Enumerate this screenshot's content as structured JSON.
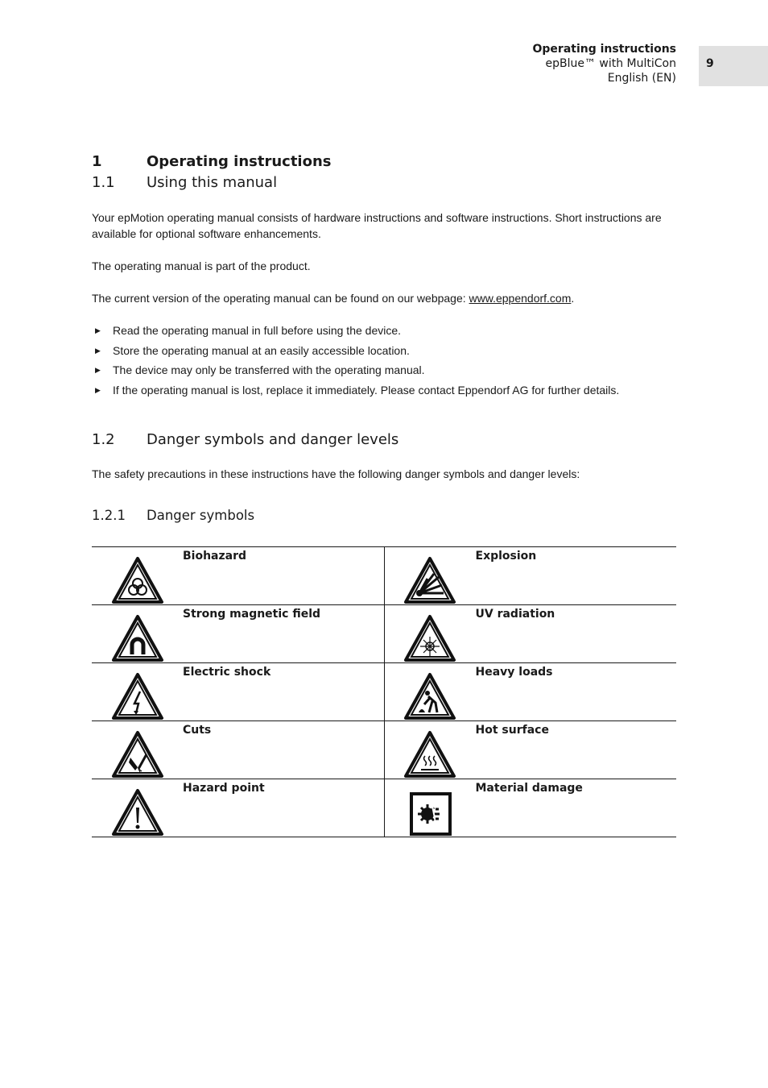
{
  "header": {
    "title": "Operating instructions",
    "product": "epBlue™ with MultiCon",
    "language": "English (EN)",
    "page_number": "9"
  },
  "sections": {
    "s1": {
      "num": "1",
      "title": "Operating instructions"
    },
    "s11": {
      "num": "1.1",
      "title": "Using this manual"
    },
    "s12": {
      "num": "1.2",
      "title": "Danger symbols and danger levels"
    },
    "s121": {
      "num": "1.2.1",
      "title": "Danger symbols"
    }
  },
  "paragraphs": {
    "p1": "Your epMotion operating manual consists of hardware instructions and software instructions. Short instructions are available for optional software enhancements.",
    "p2": "The operating manual is part of the product.",
    "p3_prefix": "The current version of the operating manual can be found on our webpage: ",
    "p3_link": "www.eppendorf.com",
    "p3_suffix": ".",
    "p4": "The safety precautions in these instructions have the following danger symbols and danger levels:"
  },
  "bullets": [
    "Read the operating manual in full before using the device.",
    "Store the operating manual at an easily accessible location.",
    "The device may only be transferred with the operating manual.",
    "If the operating manual is lost, replace it immediately. Please contact Eppendorf AG for further details."
  ],
  "symbols": [
    {
      "label": "Biohazard",
      "icon": "biohazard-icon"
    },
    {
      "label": "Explosion",
      "icon": "explosion-icon"
    },
    {
      "label": "Strong magnetic field",
      "icon": "magnet-icon"
    },
    {
      "label": "UV radiation",
      "icon": "uv-radiation-icon"
    },
    {
      "label": "Electric shock",
      "icon": "lightning-icon"
    },
    {
      "label": "Heavy loads",
      "icon": "heavy-load-icon"
    },
    {
      "label": "Cuts",
      "icon": "cut-hand-icon"
    },
    {
      "label": "Hot surface",
      "icon": "hot-surface-icon"
    },
    {
      "label": "Hazard point",
      "icon": "exclamation-icon"
    },
    {
      "label": "Material damage",
      "icon": "material-damage-icon"
    }
  ]
}
